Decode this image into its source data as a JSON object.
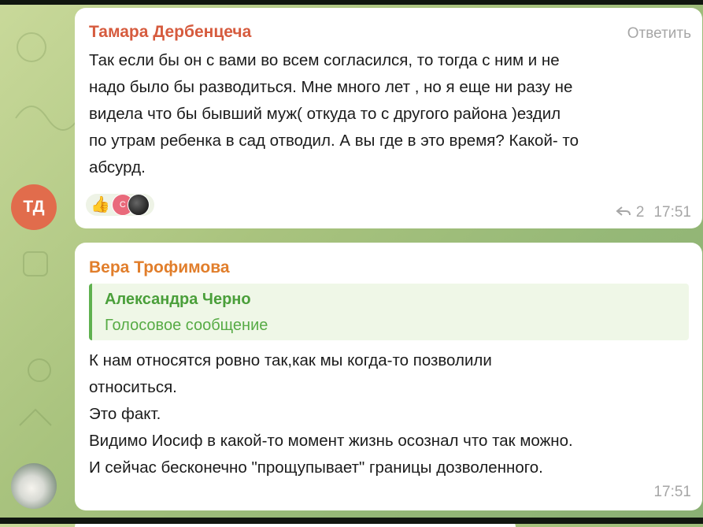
{
  "messages": [
    {
      "sender": "Тамара Дербенцеча",
      "reply_label": "Ответить",
      "text": "Так если бы он с вами во всем согласился, то тогда с ним и не\nнадо было бы разводиться. Мне много лет , но я еще ни разу не\nвидела что бы бывший муж( откуда то с другого района )ездил\nпо утрам ребенка в сад отводил. А вы где в это время? Какой- то\nабсурд.",
      "avatar_initials": "ТД",
      "reaction_mini_label": "С",
      "replies_count": "2",
      "time": "17:51"
    },
    {
      "sender": "Вера Трофимова",
      "quote": {
        "name": "Александра Черно",
        "text": "Голосовое сообщение"
      },
      "text": "К нам относятся ровно так,как мы когда-то позволили\nотноситься.\nЭто факт.\nВидимо Иосиф в какой-то момент жизнь осознал что так можно.\nИ сейчас бесконечно \"прощупывает\" границы дозволенного.",
      "time": "17:51"
    }
  ],
  "icons": {
    "reaction": "thumbs-up-icon",
    "reply_arrow": "reply-arrow-icon"
  },
  "colors": {
    "sender1": "#d65b3e",
    "sender2": "#e17e2b",
    "quote_accent": "#5fb14f",
    "avatar_td": "#e16c4c"
  }
}
